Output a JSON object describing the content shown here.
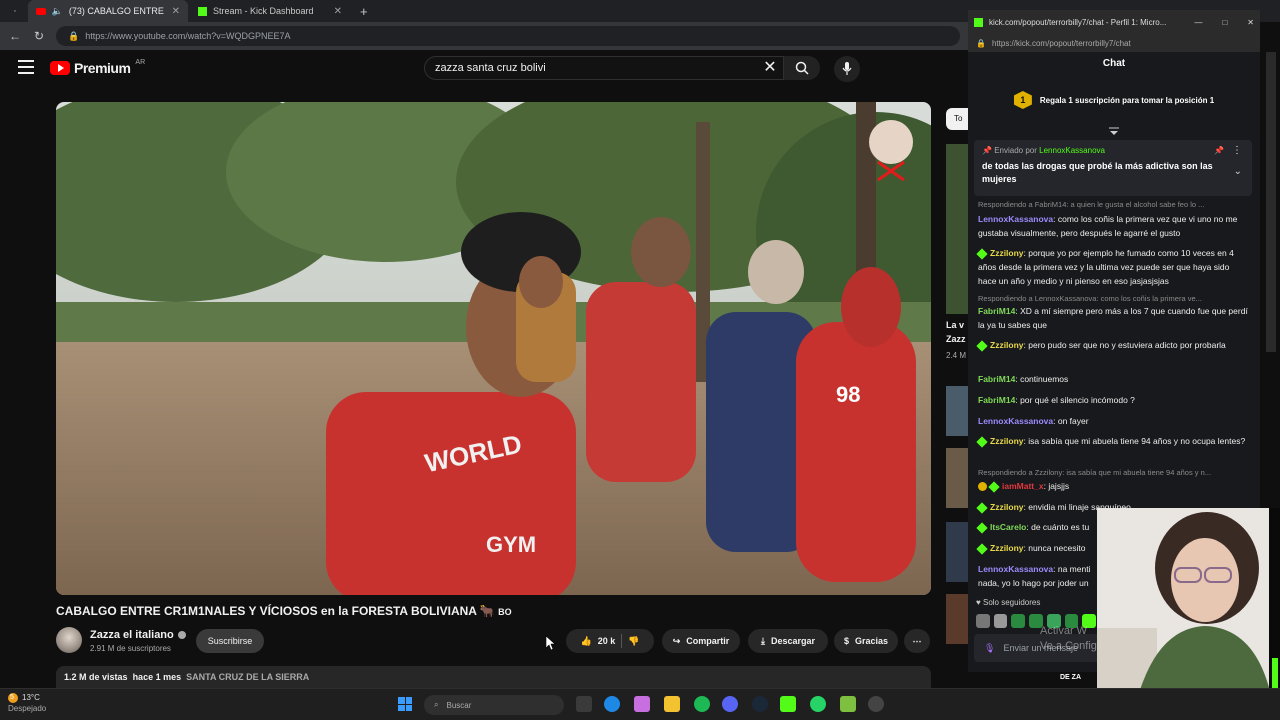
{
  "browser": {
    "tabs": [
      {
        "label": "(73) CABALGO ENTRE CR1M",
        "active": true
      },
      {
        "label": "Stream - Kick Dashboard",
        "active": false
      }
    ],
    "url": "https://www.youtube.com/watch?v=WQDGPNEE7A"
  },
  "youtube": {
    "brand": "Premium",
    "region": "AR",
    "search_query": "zazza santa cruz bolivi",
    "video": {
      "title": "CABALGO ENTRE CR1M1NALES Y VÍCIOSOS en la FORESTA BOLIVIANA",
      "title_suffix": "BO",
      "channel": "Zazza el italiano",
      "subscribers": "2.91 M de suscriptores",
      "subscribe_label": "Suscribirse",
      "likes": "20 k",
      "share_label": "Compartir",
      "download_label": "Descargar",
      "thanks_label": "Gracias",
      "views": "1.2 M de vistas",
      "age": "hace 1 mes",
      "location": "SANTA CRUZ DE LA SIERRA"
    },
    "side_fragments": [
      "To",
      "La v",
      "Zazz",
      "2.4 M",
      "DE ZA"
    ]
  },
  "kick": {
    "window_title": "kick.com/popout/terrorbilly7/chat - Perfil 1: Micro...",
    "url": "https://kick.com/popout/terrorbilly7/chat",
    "chat_title": "Chat",
    "rank": "1",
    "sub_banner": "Regala 1 suscripción para tomar la posición 1",
    "pinned": {
      "prefix": "Enviado por",
      "user": "LennoxKassanova",
      "text": "de todas las drogas que probé la más adictiva son las mujeres"
    },
    "messages": [
      {
        "reply": "Respondiendo a FabriM14: a quien le gusta el alcohol sabe feo lo ..."
      },
      {
        "user": "LennoxKassanova",
        "color": "#9b8cff",
        "text": "como los coñis la primera vez que vi uno no me gustaba visualmente, pero después le agarré el gusto"
      },
      {
        "user": "Zzzilony",
        "color": "#e8d84a",
        "text": "porque yo por ejemplo he fumado como 10 veces en 4 años desde la primera vez y la ultima vez puede ser que haya sido hace un año y medio y ni pienso en eso jasjasjsjas"
      },
      {
        "reply": "Respondiendo a LennoxKassanova: como los coñis la primera ve..."
      },
      {
        "user": "FabriM14",
        "color": "#7fd957",
        "text": "XD a mí siempre pero más a los 7 que cuando fue que perdí la ya tu sabes que"
      },
      {
        "user": "Zzzilony",
        "color": "#e8d84a",
        "text": "pero pudo ser que no y estuviera adicto por probarla"
      },
      {
        "user": "FabriM14",
        "color": "#7fd957",
        "text": "continuemos"
      },
      {
        "user": "FabriM14",
        "color": "#7fd957",
        "text": "por qué el silencio incómodo ?"
      },
      {
        "user": "LennoxKassanova",
        "color": "#9b8cff",
        "text": "on fayer"
      },
      {
        "user": "Zzzilony",
        "color": "#e8d84a",
        "text": "isa sabía que mi abuela tiene 94 años y no ocupa lentes?"
      },
      {
        "reply": "Respondiendo a Zzzilony: isa sabía que mi abuela tiene 94 años y n..."
      },
      {
        "user": "iamMatt_x",
        "color": "#e0383e",
        "text": "jajsjjs"
      },
      {
        "user": "Zzzilony",
        "color": "#e8d84a",
        "text": "envidia mi linaje sanguíneo"
      },
      {
        "user": "ItsCarelo",
        "color": "#7fd957",
        "text": "de cuánto es tu"
      },
      {
        "user": "Zzzilony",
        "color": "#e8d84a",
        "text": "nunca necesito"
      },
      {
        "user": "LennoxKassanova",
        "color": "#9b8cff",
        "text": "na menti nada, yo lo hago por joder un"
      }
    ],
    "followers_only": "Solo seguidores",
    "input_placeholder": "Enviar un mensaje"
  },
  "overlay": {
    "activate_windows": "Activar W",
    "activate_windows_2": "Ve a Configu"
  },
  "taskbar": {
    "temperature": "13°C",
    "weather_status": "Despejado",
    "search_placeholder": "Buscar",
    "notification_count": "5"
  },
  "colors": {
    "kick_green": "#53fc18",
    "youtube_red": "#ff0000"
  }
}
